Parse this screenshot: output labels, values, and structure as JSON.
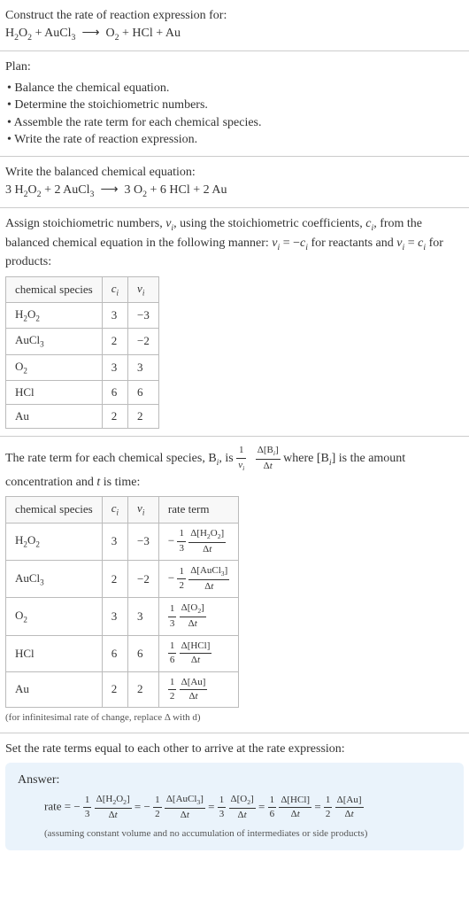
{
  "intro": {
    "title": "Construct the rate of reaction expression for:",
    "equation_html": "H<sub>2</sub>O<sub>2</sub> + AuCl<sub>3</sub> &nbsp;⟶&nbsp; O<sub>2</sub> + HCl + Au"
  },
  "plan": {
    "title": "Plan:",
    "items": [
      "• Balance the chemical equation.",
      "• Determine the stoichiometric numbers.",
      "• Assemble the rate term for each chemical species.",
      "• Write the rate of reaction expression."
    ]
  },
  "balanced": {
    "title": "Write the balanced chemical equation:",
    "equation_html": "3 H<sub>2</sub>O<sub>2</sub> + 2 AuCl<sub>3</sub> &nbsp;⟶&nbsp; 3 O<sub>2</sub> + 6 HCl + 2 Au"
  },
  "assign": {
    "text_html": "Assign stoichiometric numbers, <i>ν<sub>i</sub></i>, using the stoichiometric coefficients, <i>c<sub>i</sub></i>, from the balanced chemical equation in the following manner: <i>ν<sub>i</sub></i> = −<i>c<sub>i</sub></i> for reactants and <i>ν<sub>i</sub></i> = <i>c<sub>i</sub></i> for products:",
    "headers": [
      "chemical species",
      "cᵢ",
      "νᵢ"
    ],
    "rows": [
      {
        "species_html": "H<sub>2</sub>O<sub>2</sub>",
        "c": "3",
        "nu": "−3"
      },
      {
        "species_html": "AuCl<sub>3</sub>",
        "c": "2",
        "nu": "−2"
      },
      {
        "species_html": "O<sub>2</sub>",
        "c": "3",
        "nu": "3"
      },
      {
        "species_html": "HCl",
        "c": "6",
        "nu": "6"
      },
      {
        "species_html": "Au",
        "c": "2",
        "nu": "2"
      }
    ]
  },
  "rateterm": {
    "intro_html": "The rate term for each chemical species, B<sub><i>i</i></sub>, is ",
    "frac1_num_html": "1",
    "frac1_den_html": "<i>ν<sub>i</sub></i>",
    "frac2_num_html": "Δ[B<sub><i>i</i></sub>]",
    "frac2_den_html": "Δ<i>t</i>",
    "after_html": " where [B<sub><i>i</i></sub>] is the amount concentration and <i>t</i> is time:",
    "headers": [
      "chemical species",
      "cᵢ",
      "νᵢ",
      "rate term"
    ],
    "rows": [
      {
        "species_html": "H<sub>2</sub>O<sub>2</sub>",
        "c": "3",
        "nu": "−3",
        "sign": "−",
        "coef_num": "1",
        "coef_den": "3",
        "dnum": "Δ[H<sub>2</sub>O<sub>2</sub>]",
        "dden": "Δ<i>t</i>"
      },
      {
        "species_html": "AuCl<sub>3</sub>",
        "c": "2",
        "nu": "−2",
        "sign": "−",
        "coef_num": "1",
        "coef_den": "2",
        "dnum": "Δ[AuCl<sub>3</sub>]",
        "dden": "Δ<i>t</i>"
      },
      {
        "species_html": "O<sub>2</sub>",
        "c": "3",
        "nu": "3",
        "sign": "",
        "coef_num": "1",
        "coef_den": "3",
        "dnum": "Δ[O<sub>2</sub>]",
        "dden": "Δ<i>t</i>"
      },
      {
        "species_html": "HCl",
        "c": "6",
        "nu": "6",
        "sign": "",
        "coef_num": "1",
        "coef_den": "6",
        "dnum": "Δ[HCl]",
        "dden": "Δ<i>t</i>"
      },
      {
        "species_html": "Au",
        "c": "2",
        "nu": "2",
        "sign": "",
        "coef_num": "1",
        "coef_den": "2",
        "dnum": "Δ[Au]",
        "dden": "Δ<i>t</i>"
      }
    ],
    "note": "(for infinitesimal rate of change, replace Δ with d)"
  },
  "final": {
    "title": "Set the rate terms equal to each other to arrive at the rate expression:",
    "answer_label": "Answer:",
    "rate_prefix": "rate = ",
    "terms": [
      {
        "sign": "−",
        "coef_num": "1",
        "coef_den": "3",
        "dnum": "Δ[H<sub>2</sub>O<sub>2</sub>]",
        "dden": "Δ<i>t</i>"
      },
      {
        "sign": "−",
        "coef_num": "1",
        "coef_den": "2",
        "dnum": "Δ[AuCl<sub>3</sub>]",
        "dden": "Δ<i>t</i>"
      },
      {
        "sign": "",
        "coef_num": "1",
        "coef_den": "3",
        "dnum": "Δ[O<sub>2</sub>]",
        "dden": "Δ<i>t</i>"
      },
      {
        "sign": "",
        "coef_num": "1",
        "coef_den": "6",
        "dnum": "Δ[HCl]",
        "dden": "Δ<i>t</i>"
      },
      {
        "sign": "",
        "coef_num": "1",
        "coef_den": "2",
        "dnum": "Δ[Au]",
        "dden": "Δ<i>t</i>"
      }
    ],
    "note": "(assuming constant volume and no accumulation of intermediates or side products)"
  }
}
